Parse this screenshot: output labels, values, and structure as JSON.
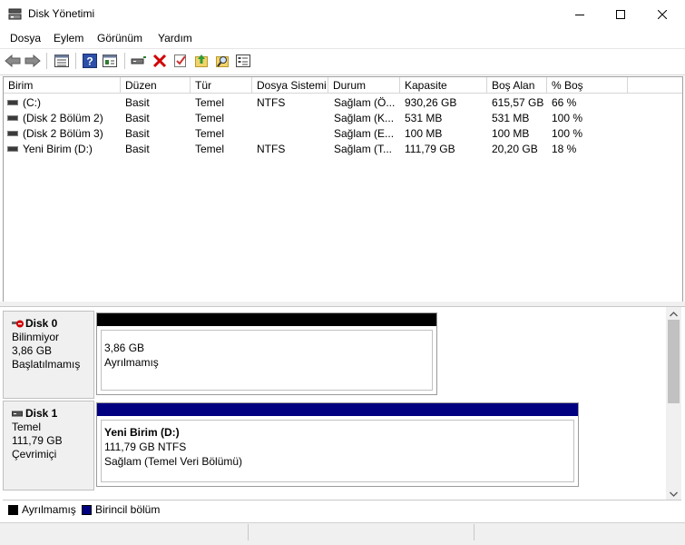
{
  "window": {
    "title": "Disk Yönetimi"
  },
  "menu": [
    "Dosya",
    "Eylem",
    "Görünüm",
    "Yardım"
  ],
  "toolbar": {
    "icons": [
      "back-icon",
      "forward-icon",
      "list-view-icon",
      "help-icon",
      "properties-icon",
      "rescan-icon",
      "delete-icon",
      "check-icon",
      "up-icon",
      "search-icon",
      "console-icon"
    ]
  },
  "volumes": {
    "headers": [
      "Birim",
      "Düzen",
      "Tür",
      "Dosya Sistemi",
      "Durum",
      "Kapasite",
      "Boş Alan",
      "% Boş"
    ],
    "rows": [
      [
        "(C:)",
        "Basit",
        "Temel",
        "NTFS",
        "Sağlam (Ö...",
        "930,26 GB",
        "615,57 GB",
        "66 %"
      ],
      [
        "(Disk 2 Bölüm 2)",
        "Basit",
        "Temel",
        "",
        "Sağlam (K...",
        "531 MB",
        "531 MB",
        "100 %"
      ],
      [
        "(Disk 2 Bölüm 3)",
        "Basit",
        "Temel",
        "",
        "Sağlam (E...",
        "100 MB",
        "100 MB",
        "100 %"
      ],
      [
        "Yeni Birim (D:)",
        "Basit",
        "Temel",
        "NTFS",
        "Sağlam (T...",
        "111,79 GB",
        "20,20 GB",
        "18 %"
      ]
    ]
  },
  "disks": [
    {
      "name": "Disk 0",
      "type": "Bilinmiyor",
      "size": "3,86 GB",
      "status": "Başlatılmamış",
      "partition": {
        "lines": [
          "3,86 GB",
          "Ayrılmamış"
        ],
        "color": "#000000"
      }
    },
    {
      "name": "Disk 1",
      "type": "Temel",
      "size": "111,79 GB",
      "status": "Çevrimiçi",
      "partition": {
        "title": "Yeni Birim  (D:)",
        "lines": [
          "111,79 GB NTFS",
          "Sağlam (Temel Veri Bölümü)"
        ],
        "color": "#000080"
      }
    }
  ],
  "legend": [
    {
      "label": "Ayrılmamış",
      "color": "#000000"
    },
    {
      "label": "Birincil bölüm",
      "color": "#000080"
    }
  ]
}
